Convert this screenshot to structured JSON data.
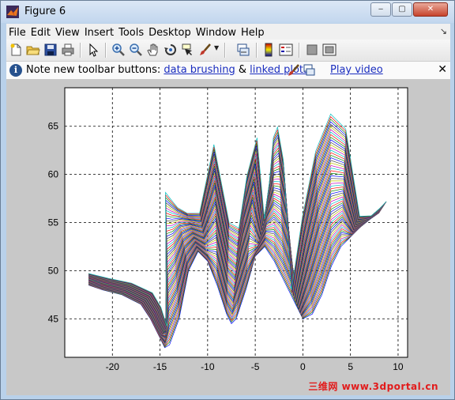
{
  "window": {
    "title": "Figure 6",
    "minimize_glyph": "‒",
    "maximize_glyph": "▢",
    "close_glyph": "✕"
  },
  "menu": [
    "File",
    "Edit",
    "View",
    "Insert",
    "Tools",
    "Desktop",
    "Window",
    "Help"
  ],
  "menu_dock_glyph": "↘",
  "toolbar_icons": [
    "new-figure-icon",
    "open-file-icon",
    "save-icon",
    "print-icon",
    "pointer-icon",
    "zoom-in-icon",
    "zoom-out-icon",
    "pan-hand-icon",
    "rotate-3d-icon",
    "data-cursor-icon",
    "brush-icon",
    "dropdown-arrow-icon",
    "link-plot-icon",
    "colorbar-icon",
    "legend-icon",
    "hide-plot-tools-icon",
    "show-plot-tools-icon"
  ],
  "infobar": {
    "icon_glyph": "i",
    "prefix": "Note new toolbar buttons: ",
    "link1": "data brushing",
    "amp": " & ",
    "link2": "linked plots",
    "link3": "Play video",
    "close_glyph": "✕"
  },
  "chart_data": {
    "type": "line",
    "title": "",
    "xlabel": "",
    "ylabel": "",
    "xlim": [
      -25,
      11
    ],
    "ylim": [
      41,
      69
    ],
    "xticks": [
      -20,
      -15,
      -10,
      -5,
      0,
      5,
      10
    ],
    "yticks": [
      45,
      50,
      55,
      60,
      65
    ],
    "grid": "dashed",
    "series_count": 60,
    "series_colors": [
      "#0000ff",
      "#008000",
      "#ff0000",
      "#00bfbf",
      "#bf00bf",
      "#bfbf00",
      "#404040"
    ],
    "base_curve": {
      "x": [
        -22.5,
        -21,
        -19,
        -17,
        -16,
        -15,
        -14.5,
        -14,
        -13,
        -12,
        -11,
        -10,
        -9,
        -8,
        -7.5,
        -7,
        -6,
        -5,
        -4,
        -3,
        -2,
        -1,
        0,
        1,
        2,
        3,
        4,
        5,
        6,
        7,
        8
      ],
      "y": [
        48.5,
        48.0,
        47.5,
        46.5,
        45.0,
        43.0,
        42.0,
        42.3,
        45.0,
        50.0,
        52.0,
        51.0,
        48.5,
        45.5,
        44.5,
        45.0,
        48.0,
        51.5,
        52.5,
        51.0,
        49.0,
        47.0,
        45.0,
        45.5,
        47.5,
        50.5,
        52.5,
        53.5,
        54.5,
        55.3,
        56.0
      ]
    }
  },
  "watermark": "三维网 www.3dportal.cn"
}
